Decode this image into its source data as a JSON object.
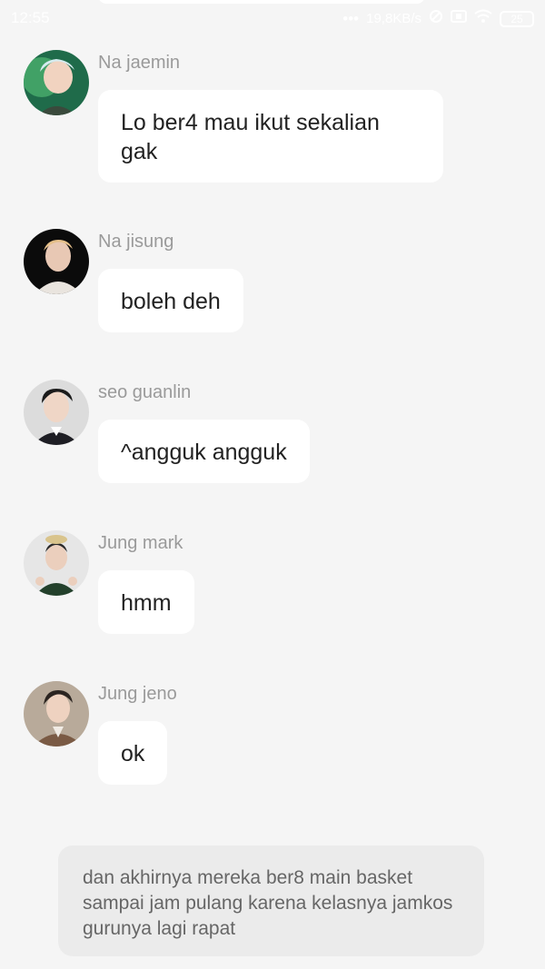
{
  "status_bar": {
    "time": "12:55",
    "speed": "19,8KB/s",
    "battery": "25",
    "icons": [
      "signal-dots-icon",
      "data-saver-icon",
      "sim-icon",
      "wifi-icon",
      "battery-icon"
    ]
  },
  "messages": [
    {
      "sender": "Na jaemin",
      "text": "Lo ber4 mau ikut sekalian gak",
      "avatar": "avatar-na-jaemin"
    },
    {
      "sender": "Na jisung",
      "text": "boleh deh",
      "avatar": "avatar-na-jisung"
    },
    {
      "sender": "seo guanlin",
      "text": "^angguk angguk",
      "avatar": "avatar-seo-guanlin"
    },
    {
      "sender": "Jung mark",
      "text": "hmm",
      "avatar": "avatar-jung-mark"
    },
    {
      "sender": "Jung jeno",
      "text": "ok",
      "avatar": "avatar-jung-jeno"
    }
  ],
  "narration": {
    "text": "dan akhirnya mereka ber8 main basket sampai jam pulang karena kelasnya jamkos gurunya lagi rapat"
  },
  "colors": {
    "background": "#f5f5f5",
    "bubble": "#ffffff",
    "narration_bg": "#ebebeb",
    "sender_text": "#9a9a9a",
    "message_text": "#222222"
  }
}
